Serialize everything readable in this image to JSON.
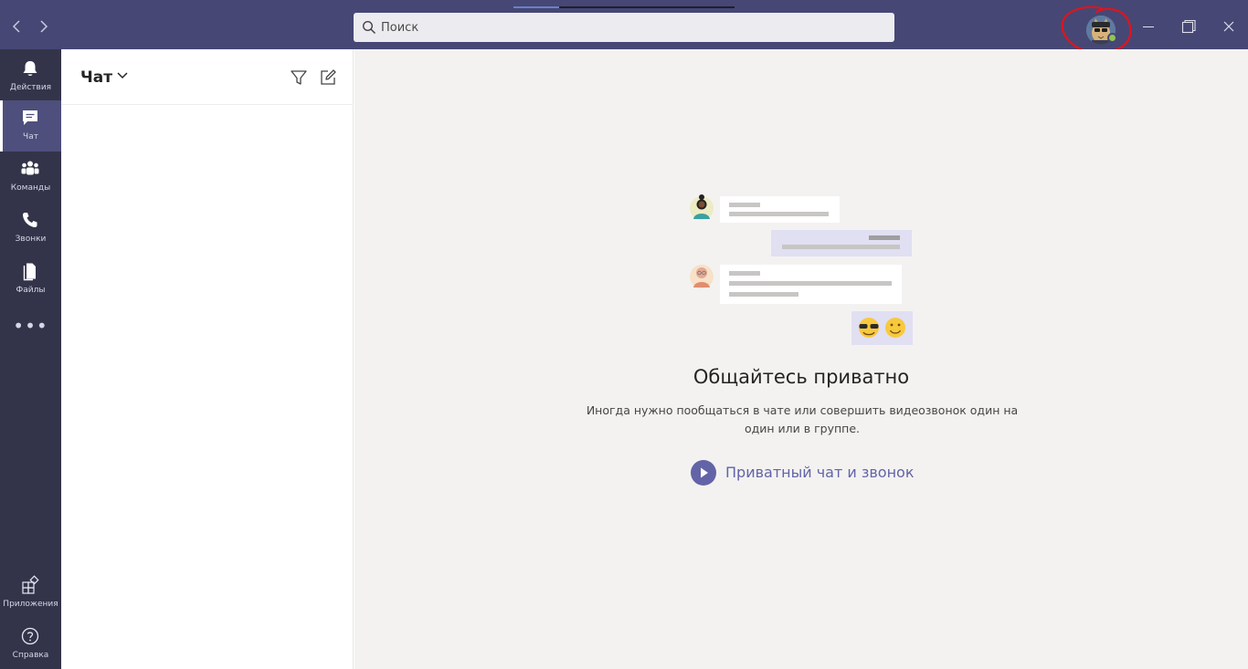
{
  "colors": {
    "titlebar": "#464775",
    "rail": "#33344a",
    "accent": "#6264a7",
    "main_bg": "#f3f2f1",
    "presence_available": "#92c353",
    "annotation": "#e0141c"
  },
  "titlebar": {
    "back_icon": "chevron-left-icon",
    "forward_icon": "chevron-right-icon",
    "search": {
      "placeholder": "Поиск",
      "icon": "search-icon"
    },
    "window_controls": [
      "minimize-icon",
      "maximize-icon",
      "close-icon"
    ]
  },
  "rail": {
    "items": [
      {
        "label": "Действия",
        "icon": "bell-icon",
        "active": false
      },
      {
        "label": "Чат",
        "icon": "chat-icon",
        "active": true
      },
      {
        "label": "Команды",
        "icon": "teams-icon",
        "active": false
      },
      {
        "label": "Звонки",
        "icon": "phone-icon",
        "active": false
      },
      {
        "label": "Файлы",
        "icon": "files-icon",
        "active": false
      }
    ],
    "more_label": "•••",
    "bottom_items": [
      {
        "label": "Приложения",
        "icon": "apps-icon"
      },
      {
        "label": "Справка",
        "icon": "help-icon"
      }
    ]
  },
  "chat_list": {
    "title": "Чат",
    "icons": [
      "chevron-down-icon",
      "filter-icon",
      "new-chat-icon"
    ]
  },
  "main": {
    "title": "Общайтесь приватно",
    "description": "Иногда нужно пообщаться в чате или совершить видеозвонок один на один или в группе.",
    "cta_label": "Приватный чат и звонок",
    "emojis": [
      "😎",
      "🙂"
    ]
  }
}
